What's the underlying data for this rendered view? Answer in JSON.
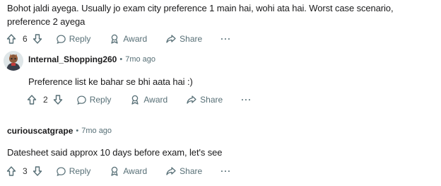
{
  "comment1": {
    "text": "Bohot jaldi ayega. Usually jo exam city preference 1 main hai, wohi ata hai. Worst case scenario, preference 2 ayega",
    "votes": "6",
    "reply_label": "Reply",
    "award_label": "Award",
    "share_label": "Share",
    "more_label": "···"
  },
  "comment2": {
    "author": "Internal_Shopping260",
    "separator": "•",
    "time": "7mo ago",
    "text": "Preference list ke bahar se bhi aata hai :)",
    "votes": "2",
    "reply_label": "Reply",
    "award_label": "Award",
    "share_label": "Share",
    "more_label": "···"
  },
  "comment3": {
    "author": "curiouscatgrape",
    "separator": "•",
    "time": "7mo ago",
    "text": "Datesheet said approx 10 days before exam, let's see",
    "votes": "3",
    "reply_label": "Reply",
    "award_label": "Award",
    "share_label": "Share",
    "more_label": "···"
  },
  "icons": {
    "upvote": "upvote-icon",
    "downvote": "downvote-icon",
    "reply": "reply-icon",
    "award": "award-icon",
    "share": "share-icon",
    "more": "more-icon"
  },
  "colors": {
    "action_text": "#576f76",
    "body_text": "#1a1a1b"
  }
}
